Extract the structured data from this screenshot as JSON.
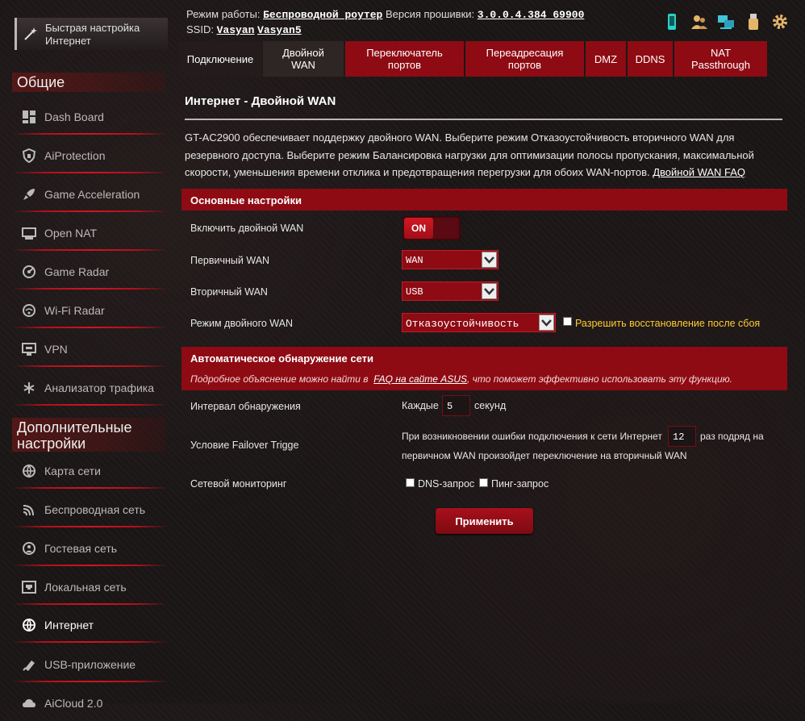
{
  "header": {
    "mode_label": "Режим работы:",
    "mode_value": "Беспроводной роутер",
    "fw_label": "Версия прошивки:",
    "fw_value": "3.0.0.4.384_69900",
    "ssid_label": "SSID:",
    "ssid_1": "Vasyan",
    "ssid_2": "Vasyan5",
    "icons": [
      "mobile-icon",
      "users-icon",
      "network-icon",
      "usb-icon",
      "gear-icon"
    ]
  },
  "sidebar": {
    "quick_setup": "Быстрая настройка Интернет",
    "general_title": "Общие",
    "general_items": [
      {
        "label": "Dash Board",
        "icon": "dashboard-icon"
      },
      {
        "label": "AiProtection",
        "icon": "shield-icon"
      },
      {
        "label": "Game Acceleration",
        "icon": "rocket-icon"
      },
      {
        "label": "Open NAT",
        "icon": "open-nat-icon"
      },
      {
        "label": "Game Radar",
        "icon": "radar-icon"
      },
      {
        "label": "Wi-Fi Radar",
        "icon": "wifi-radar-icon"
      },
      {
        "label": "VPN",
        "icon": "vpn-icon"
      },
      {
        "label": "Анализатор трафика",
        "icon": "traffic-icon"
      }
    ],
    "advanced_title": "Дополнительные настройки",
    "advanced_items": [
      {
        "label": "Карта сети",
        "icon": "globe-icon"
      },
      {
        "label": "Беспроводная сеть",
        "icon": "wireless-icon"
      },
      {
        "label": "Гостевая сеть",
        "icon": "guest-icon"
      },
      {
        "label": "Локальная сеть",
        "icon": "lan-icon"
      },
      {
        "label": "Интернет",
        "icon": "internet-icon"
      },
      {
        "label": "USB-приложение",
        "icon": "usb-app-icon"
      },
      {
        "label": "AiCloud 2.0",
        "icon": "cloud-icon"
      }
    ]
  },
  "tabs": [
    {
      "label": "Подключение"
    },
    {
      "label": "Двойной WAN"
    },
    {
      "label": "Переключатель портов"
    },
    {
      "label": "Переадресация портов"
    },
    {
      "label": "DMZ"
    },
    {
      "label": "DDNS"
    },
    {
      "label": "NAT Passthrough"
    }
  ],
  "main": {
    "title": "Интернет - Двойной WAN",
    "description": "GT-AC2900 обеспечивает поддержку двойного WAN. Выберите режим Отказоустойчивость вторичного WAN для резервного доступа. Выберите режим Балансировка нагрузки для оптимизации полосы пропускания, максимальной скорости, уменьшения времени отклика и предотвращения перегрузки для обоих WAN-портов.",
    "faq_link": "Двойной WAN FAQ",
    "basic": {
      "title": "Основные настройки",
      "enable_label": "Включить двойной WAN",
      "toggle_state": "ON",
      "primary_label": "Первичный WAN",
      "primary_value": "WAN",
      "secondary_label": "Вторичный WAN",
      "secondary_value": "USB",
      "mode_label": "Режим двойного WAN",
      "mode_value": "Отказоустойчивость",
      "failback_label": "Разрешить восстановление после сбоя",
      "failback_checked": false
    },
    "detect": {
      "title": "Автоматическое обнаружение сети",
      "subtitle_pre": "Подробное объяснение можно найти в",
      "subtitle_link": "FAQ на сайте ASUS",
      "subtitle_post": ", что поможет эффективно использовать эту функцию.",
      "interval_label": "Интервал обнаружения",
      "every": "Каждые",
      "interval_value": "5",
      "seconds": "секунд",
      "failover_label": "Условие Failover Trigge",
      "failover_pre": "При возникновении ошибки подключения к сети Интернет",
      "failover_value": "12",
      "failover_post_1": "раз подряд на",
      "failover_post_2": "первичном WAN произойдет переключение на вторичный WAN",
      "monitor_label": "Сетевой мониторинг",
      "dns_label": "DNS-запрос",
      "ping_label": "Пинг-запрос"
    },
    "apply_label": "Применить"
  },
  "colors": {
    "accent": "#8e0b14",
    "background": "#1a1616",
    "highlight": "#ffcc33"
  }
}
